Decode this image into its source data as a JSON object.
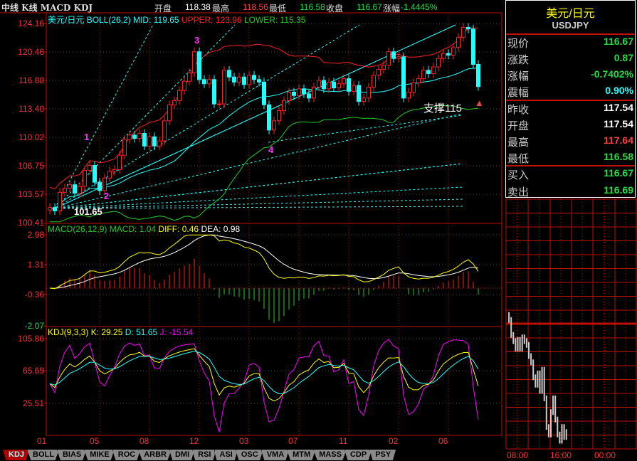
{
  "header": {
    "title": "中线 K线 MACD KDJ",
    "open_label": "开盘",
    "open": "118.38",
    "high_label": "最高",
    "high": "118.56",
    "low_label": "最低",
    "low": "116.58",
    "close_label": "收盘",
    "close": "116.67",
    "change_label": "涨幅",
    "change": "-1.4445%"
  },
  "price_panel": {
    "legend_name": "美元/日元",
    "legend_boll": "BOLL(26,2)",
    "mid": "MID: 119.65",
    "upper": "UPPER: 123.96",
    "lower": "LOWER: 115.35",
    "y_ticks": [
      "124.16",
      "120.46",
      "116.88",
      "113.40",
      "110.02",
      "106.75",
      "103.57",
      "100.41"
    ],
    "annotations": {
      "wave1": "1",
      "wave2": "2",
      "wave3": "3",
      "wave4": "4",
      "low_value": "101.65",
      "support": "支撑115"
    },
    "close": [
      102.3,
      101.9,
      104.1,
      104.6,
      105.0,
      104.0,
      104.8,
      106.7,
      107.3,
      105.3,
      104.3,
      105.8,
      106.6,
      106.8,
      108.5,
      110.4,
      110.9,
      110.5,
      111.1,
      109.6,
      110.7,
      109.6,
      110.2,
      112.6,
      114.5,
      115.0,
      116.2,
      117.3,
      118.3,
      120.8,
      117.5,
      117.0,
      117.5,
      114.6,
      114.6,
      118.6,
      117.8,
      117.2,
      117.8,
      116.9,
      118.0,
      117.5,
      117.2,
      114.5,
      111.5,
      112.6,
      113.8,
      115.0,
      116.0,
      115.6,
      116.4,
      115.8,
      115.3,
      116.6,
      117.4,
      116.4,
      117.2,
      116.5,
      117.0,
      117.6,
      116.1,
      116.8,
      114.9,
      115.3,
      116.6,
      118.0,
      118.7,
      119.2,
      120.8,
      120.0,
      120.2,
      115.3,
      116.0,
      117.1,
      117.6,
      118.6,
      118.2,
      119.0,
      120.0,
      120.6,
      120.4,
      121.3,
      122.5,
      123.7,
      123.5,
      119.3,
      116.67
    ]
  },
  "macd_panel": {
    "legend_name": "MACD(26,12,9)",
    "macd": "MACD: 1.04",
    "diff": "DIFF: 0.46",
    "dea": "DEA: 0.98",
    "y_ticks": [
      "2.98",
      "1.31",
      "-0.36",
      "-2.07"
    ]
  },
  "kdj_panel": {
    "legend_name": "KDJ(9,3,3)",
    "k": "K: 29.25",
    "d": "D: 51.65",
    "j": "J: -15.54",
    "y_ticks": [
      "105.86",
      "65.69",
      "25.51"
    ]
  },
  "x_ticks": [
    "01",
    "05",
    "08",
    "12",
    "03",
    "07",
    "11",
    "02",
    "06"
  ],
  "tabs": [
    "KDJ",
    "BOLL",
    "BIAS",
    "MIKE",
    "ROC",
    "ARBR",
    "DMI",
    "RSI",
    "ASI",
    "OSC",
    "VMA",
    "MTM",
    "MASS",
    "CDP",
    "PSY"
  ],
  "active_tab": "KDJ",
  "quote": {
    "name": "美元/日元",
    "symbol": "USDJPY",
    "rows": [
      {
        "label": "现价",
        "value": "116.67",
        "color": "#22dd44"
      },
      {
        "label": "涨跌",
        "value": "0.87",
        "color": "#22dd44"
      },
      {
        "label": "涨幅",
        "value": "-0.7402%",
        "color": "#22dd44"
      },
      {
        "label": "震幅",
        "value": "0.90%",
        "color": "#22ffff"
      },
      {
        "label": "昨收",
        "value": "117.54",
        "color": "#ffffff"
      },
      {
        "label": "开盘",
        "value": "117.54",
        "color": "#ffffff"
      },
      {
        "label": "最高",
        "value": "117.64",
        "color": "#ff4040"
      },
      {
        "label": "最低",
        "value": "116.58",
        "color": "#22dd44"
      },
      {
        "label": "买入",
        "value": "116.67",
        "color": "#22dd44"
      },
      {
        "label": "卖出",
        "value": "116.69",
        "color": "#22dd44"
      }
    ]
  },
  "intraday": {
    "time_ticks": [
      "08:00",
      "16:00",
      "00:00"
    ],
    "prev_close": 117.54,
    "prices": [
      117.61,
      117.57,
      117.45,
      117.4,
      117.34,
      117.41,
      117.34,
      117.43,
      117.4,
      117.37,
      117.28,
      117.23,
      117.11,
      117.05,
      117.14,
      117.0,
      117.17,
      116.94,
      116.71,
      116.65,
      116.83,
      116.94,
      116.77,
      116.65,
      116.6,
      116.71,
      116.63,
      116.67
    ]
  },
  "colors": {
    "up": "#ff2020",
    "down": "#22ffff",
    "frame": "#c01000",
    "grid": "#c01000",
    "boll_upper": "#ff2020",
    "boll_mid": "#22ffff",
    "boll_lower": "#22cc22",
    "diff": "#ffff00",
    "dea": "#ffffff",
    "k": "#ffff00",
    "d": "#22ffff",
    "j": "#ff00ff"
  }
}
